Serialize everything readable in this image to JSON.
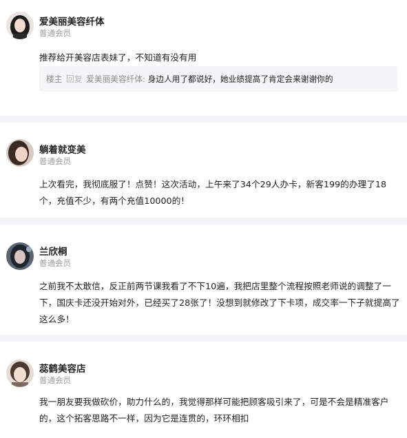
{
  "posts": [
    {
      "author": "爱美丽美容纤体",
      "level": "普通会员",
      "avatar_icon": "avatar-woman-icon",
      "content": "推荐给开美容店表妹了，不知道有没有用",
      "reply": {
        "prefix": "楼主",
        "action": "回复",
        "to": "爱美丽美容纤体:",
        "text": "身边人用了都说好，她业绩提高了肯定会来谢谢你的"
      }
    },
    {
      "author": "躺着就变美",
      "level": "普通会员",
      "avatar_icon": "avatar-woman-icon",
      "content": "上次看完，我彻底服了！点赞！这次活动，上午来了34个29人办卡，新客199的办理了18个，充值不少，有两个充值10000的！"
    },
    {
      "author": "兰欣桐",
      "level": "普通会员",
      "avatar_icon": "avatar-woman-icon",
      "content": "之前我不太敢信，反正前两节课我看了不下10遍，我把店里整个流程按照老师说的调整了一下，国庆卡还没开始对外，已经买了28张了！没想到就修改了下卡项，成交率一下子就提高了这么多！"
    },
    {
      "author": "蕊鹤美容店",
      "level": "普通会员",
      "avatar_icon": "avatar-woman-icon",
      "content": "我一朋友要我做砍价，助力什么的，我觉得那样可能把顾客吸引来了，可是不会是精准客户的，这个拓客思路不一样，因为它是连贯的，环环相扣"
    }
  ],
  "colors": {
    "separator": "#f2f3f5",
    "reply_bg": "#f4f5f7",
    "muted_text": "#9a9a9a"
  }
}
